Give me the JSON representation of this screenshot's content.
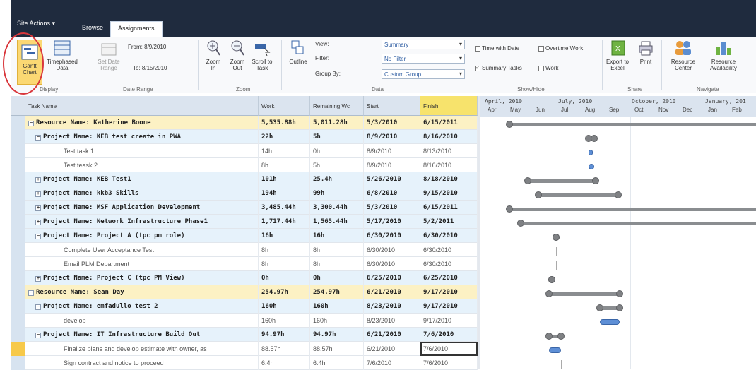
{
  "topbar": {
    "site_actions": "Site Actions ▾",
    "tab_browse": "Browse",
    "tab_assignments": "Assignments"
  },
  "ribbon": {
    "gantt_chart": "Gantt Chart",
    "timephased_data": "Timephased Data",
    "set_date_range": "Set Date Range",
    "from_label": "From:",
    "from_value": "8/9/2010",
    "to_label": "To:",
    "to_value": "8/15/2010",
    "zoom_in": "Zoom In",
    "zoom_out": "Zoom Out",
    "scroll_to_task": "Scroll to Task",
    "outline": "Outline",
    "view_label": "View:",
    "view_value": "Summary",
    "filter_label": "Filter:",
    "filter_value": "No Filter",
    "groupby_label": "Group By:",
    "groupby_value": "Custom Group...",
    "time_with_date": "Time with Date",
    "overtime_work": "Overtime Work",
    "summary_tasks": "Summary Tasks",
    "work": "Work",
    "export_excel": "Export to Excel",
    "print": "Print",
    "resource_center": "Resource Center",
    "resource_availability": "Resource Availability",
    "groups": {
      "display": "Display",
      "date_range": "Date Range",
      "zoom": "Zoom",
      "data": "Data",
      "show_hide": "Show/Hide",
      "share": "Share",
      "navigate": "Navigate"
    }
  },
  "grid": {
    "columns": [
      "Task Name",
      "Work",
      "Remaining Wc",
      "Start",
      "Finish"
    ],
    "rows": [
      {
        "kind": "res",
        "exp": "⊟",
        "name": "Resource Name: Katherine Boone",
        "work": "5,535.88h",
        "remaining": "5,011.28h",
        "start": "5/3/2010",
        "finish": "6/15/2011"
      },
      {
        "kind": "proj",
        "exp": "⊟",
        "name": "Project Name: KEB test create in PWA",
        "work": "22h",
        "remaining": "5h",
        "start": "8/9/2010",
        "finish": "8/16/2010"
      },
      {
        "kind": "task",
        "name": "Test task 1",
        "work": "14h",
        "remaining": "0h",
        "start": "8/9/2010",
        "finish": "8/13/2010"
      },
      {
        "kind": "task",
        "name": "Test teask 2",
        "work": "8h",
        "remaining": "5h",
        "start": "8/9/2010",
        "finish": "8/16/2010"
      },
      {
        "kind": "proj",
        "exp": "⊞",
        "name": "Project Name: KEB Test1",
        "work": "101h",
        "remaining": "25.4h",
        "start": "5/26/2010",
        "finish": "8/18/2010"
      },
      {
        "kind": "proj",
        "exp": "⊞",
        "name": "Project Name: kkb3 Skills",
        "work": "194h",
        "remaining": "99h",
        "start": "6/8/2010",
        "finish": "9/15/2010"
      },
      {
        "kind": "proj",
        "exp": "⊞",
        "name": "Project Name: MSF Application Development",
        "work": "3,485.44h",
        "remaining": "3,300.44h",
        "start": "5/3/2010",
        "finish": "6/15/2011"
      },
      {
        "kind": "proj",
        "exp": "⊞",
        "name": "Project Name: Network Infrastructure Phase1",
        "work": "1,717.44h",
        "remaining": "1,565.44h",
        "start": "5/17/2010",
        "finish": "5/2/2011"
      },
      {
        "kind": "proj",
        "exp": "⊟",
        "name": "Project Name: Project A (tpc pm role)",
        "work": "16h",
        "remaining": "16h",
        "start": "6/30/2010",
        "finish": "6/30/2010"
      },
      {
        "kind": "task",
        "name": "Complete User Acceptance Test",
        "work": "8h",
        "remaining": "8h",
        "start": "6/30/2010",
        "finish": "6/30/2010"
      },
      {
        "kind": "task",
        "name": "Email PLM Department",
        "work": "8h",
        "remaining": "8h",
        "start": "6/30/2010",
        "finish": "6/30/2010"
      },
      {
        "kind": "proj",
        "exp": "⊞",
        "name": "Project Name: Project C (tpc PM View)",
        "work": "0h",
        "remaining": "0h",
        "start": "6/25/2010",
        "finish": "6/25/2010"
      },
      {
        "kind": "res",
        "exp": "⊟",
        "name": "Resource Name: Sean Day",
        "work": "254.97h",
        "remaining": "254.97h",
        "start": "6/21/2010",
        "finish": "9/17/2010"
      },
      {
        "kind": "proj",
        "exp": "⊟",
        "name": "Project Name: emfadullo test 2",
        "work": "160h",
        "remaining": "160h",
        "start": "8/23/2010",
        "finish": "9/17/2010"
      },
      {
        "kind": "task",
        "name": "develop",
        "work": "160h",
        "remaining": "160h",
        "start": "8/23/2010",
        "finish": "9/17/2010"
      },
      {
        "kind": "proj",
        "exp": "⊟",
        "name": "Project Name: IT Infrastructure Build Out",
        "work": "94.97h",
        "remaining": "94.97h",
        "start": "6/21/2010",
        "finish": "7/6/2010"
      },
      {
        "kind": "task",
        "name": "Finalize plans and develop estimate with owner, as",
        "work": "88.57h",
        "remaining": "88.57h",
        "start": "6/21/2010",
        "finish": "7/6/2010"
      },
      {
        "kind": "task",
        "name": "Sign contract and notice to proceed",
        "work": "6.4h",
        "remaining": "6.4h",
        "start": "7/6/2010",
        "finish": "7/6/2010"
      }
    ]
  },
  "gantt": {
    "quarters": [
      "April, 2010",
      "July, 2010",
      "October, 2010",
      "January, 201"
    ],
    "months": [
      "Apr",
      "May",
      "Jun",
      "Jul",
      "Aug",
      "Sep",
      "Oct",
      "Nov",
      "Dec",
      "Jan",
      "Feb"
    ]
  }
}
